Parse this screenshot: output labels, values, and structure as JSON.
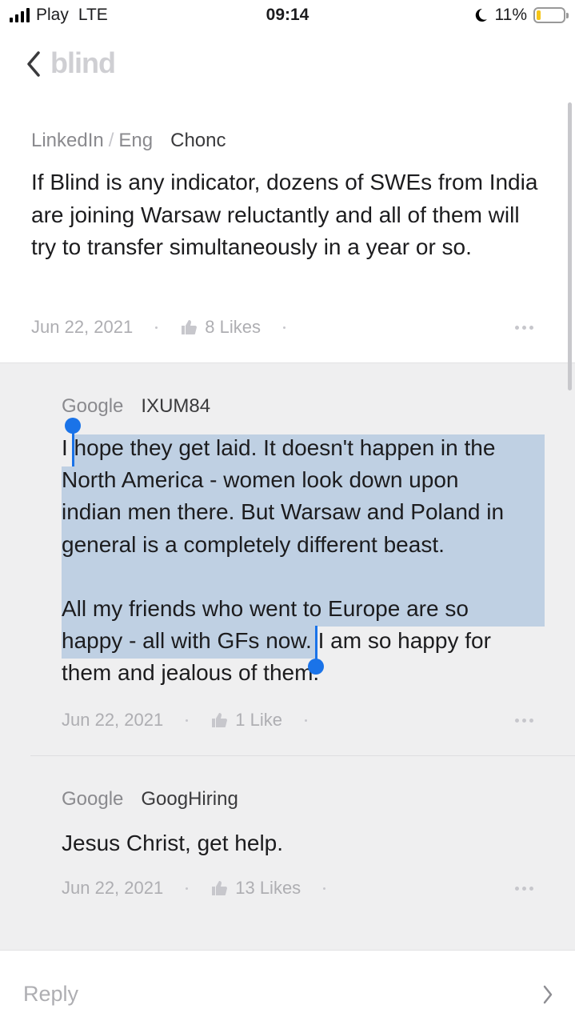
{
  "status_bar": {
    "carrier": "Play",
    "network": "LTE",
    "time": "09:14",
    "battery": "11%"
  },
  "nav": {
    "logo": "blind",
    "icons": [
      "chevron-left-icon"
    ]
  },
  "post": {
    "company": "LinkedIn",
    "separator": "/",
    "department": "Eng",
    "username": "Chonc",
    "body": "If Blind is any indicator, dozens of SWEs from India are joining Warsaw reluctantly and all of them will try to transfer simultaneously in a year or so.",
    "date": "Jun 22, 2021",
    "likes": "8 Likes"
  },
  "comments": [
    {
      "company": "Google",
      "username": "IXUM84",
      "body_line_1": "I hope they get laid. It doesn't happen in the",
      "body_line_2": "North America - women look down upon",
      "body_line_3": "indian men there. But Warsaw and Poland in",
      "body_line_4": "general is a completely different beast.",
      "body_line_6": "All my friends who went to Europe are so",
      "body_line_7": "happy - all with GFs now. I am so happy for",
      "body_line_8": "them and jealous of them.",
      "date": "Jun 22, 2021",
      "likes": "1 Like"
    },
    {
      "company": "Google",
      "username": "GoogHiring",
      "body": "Jesus Christ, get help.",
      "date": "Jun 22, 2021",
      "likes": "13 Likes"
    }
  ],
  "reply_bar": {
    "placeholder": "Reply"
  },
  "colors": {
    "selection": "#bfd0e3",
    "selection_handle": "#1a73e8",
    "logo": "#cfcfd3",
    "comments_background": "#efeff0"
  }
}
